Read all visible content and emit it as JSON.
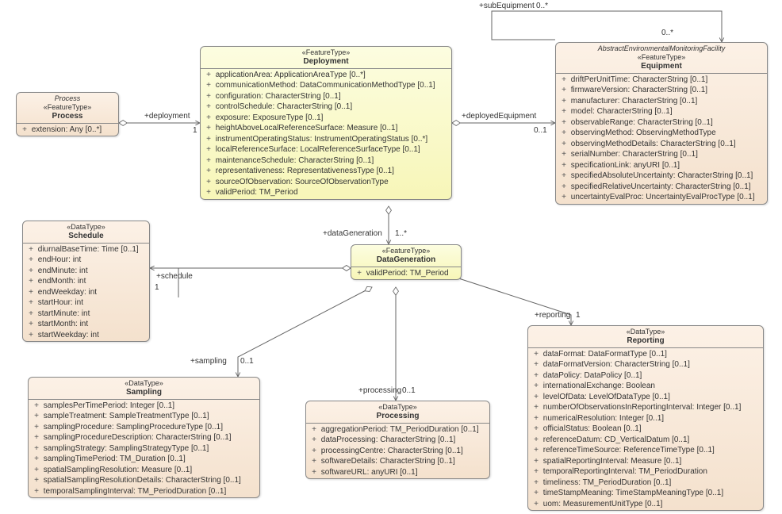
{
  "boxes": {
    "process": {
      "topnote": "Process",
      "stereo": "«FeatureType»",
      "name": "Process",
      "attrs": [
        "extension: Any [0..*]"
      ]
    },
    "deployment": {
      "stereo": "«FeatureType»",
      "name": "Deployment",
      "attrs": [
        "applicationArea: ApplicationAreaType [0..*]",
        "communicationMethod: DataCommunicationMethodType [0..1]",
        "configuration: CharacterString [0..1]",
        "controlSchedule: CharacterString [0..1]",
        "exposure: ExposureType [0..1]",
        "heightAboveLocalReferenceSurface: Measure [0..1]",
        "instrumentOperatingStatus: InstrumentOperatingStatus [0..*]",
        "localReferenceSurface: LocalReferenceSurfaceType [0..1]",
        "maintenanceSchedule: CharacterString [0..1]",
        "representativeness: RepresentativenessType [0..1]",
        "sourceOfObservation: SourceOfObservationType",
        "validPeriod: TM_Period"
      ]
    },
    "equipment": {
      "topnote": "AbstractEnvironmentalMonitoringFacility",
      "stereo": "«FeatureType»",
      "name": "Equipment",
      "attrs": [
        "driftPerUnitTime: CharacterString [0..1]",
        "firmwareVersion: CharacterString [0..1]",
        "manufacturer: CharacterString [0..1]",
        "model: CharacterString [0..1]",
        "observableRange: CharacterString [0..1]",
        "observingMethod: ObservingMethodType",
        "observingMethodDetails: CharacterString [0..1]",
        "serialNumber: CharacterString [0..1]",
        "specificationLink: anyURI [0..1]",
        "specifiedAbsoluteUncertainty: CharacterString [0..1]",
        "specifiedRelativeUncertainty: CharacterString [0..1]",
        "uncertaintyEvalProc: UncertaintyEvalProcType [0..1]"
      ]
    },
    "schedule": {
      "stereo": "«DataType»",
      "name": "Schedule",
      "attrs": [
        "diurnalBaseTime: Time [0..1]",
        "endHour: int",
        "endMinute: int",
        "endMonth: int",
        "endWeekday: int",
        "startHour: int",
        "startMinute: int",
        "startMonth: int",
        "startWeekday: int"
      ]
    },
    "datagen": {
      "stereo": "«FeatureType»",
      "name": "DataGeneration",
      "attrs": [
        "validPeriod: TM_Period"
      ]
    },
    "sampling": {
      "stereo": "«DataType»",
      "name": "Sampling",
      "attrs": [
        "samplesPerTimePeriod: Integer [0..1]",
        "sampleTreatment: SampleTreatmentType [0..1]",
        "samplingProcedure: SamplingProcedureType [0..1]",
        "samplingProcedureDescription: CharacterString [0..1]",
        "samplingStrategy: SamplingStrategyType [0..1]",
        "samplingTimePeriod: TM_Duration [0..1]",
        "spatialSamplingResolution: Measure [0..1]",
        "spatialSamplingResolutionDetails: CharacterString [0..1]",
        "temporalSamplingInterval: TM_PeriodDuration [0..1]"
      ]
    },
    "processing": {
      "stereo": "«DataType»",
      "name": "Processing",
      "attrs": [
        "aggregationPeriod: TM_PeriodDuration [0..1]",
        "dataProcessing: CharacterString [0..1]",
        "processingCentre: CharacterString [0..1]",
        "softwareDetails: CharacterString [0..1]",
        "softwareURL: anyURI [0..1]"
      ]
    },
    "reporting": {
      "stereo": "«DataType»",
      "name": "Reporting",
      "attrs": [
        "dataFormat: DataFormatType [0..1]",
        "dataFormatVersion: CharacterString [0..1]",
        "dataPolicy: DataPolicy [0..1]",
        "internationalExchange: Boolean",
        "levelOfData: LevelOfDataType [0..1]",
        "numberOfObservationsInReportingInterval: Integer [0..1]",
        "numericalResolution: Integer [0..1]",
        "officialStatus: Boolean [0..1]",
        "referenceDatum: CD_VerticalDatum [0..1]",
        "referenceTimeSource: ReferenceTimeType [0..1]",
        "spatialReportingInterval: Measure [0..1]",
        "temporalReportingInterval: TM_PeriodDuration",
        "timeliness: TM_PeriodDuration [0..1]",
        "timeStampMeaning: TimeStampMeaningType [0..1]",
        "uom: MeasurementUnitType [0..1]"
      ]
    }
  },
  "labels": {
    "subEquipment": "+subEquipment",
    "subEquipMult1": "0..*",
    "subEquipMult2": "0..*",
    "deployment": "+deployment",
    "deploymentMult": "1",
    "deployedEquipment": "+deployedEquipment",
    "deployedEquipmentMult": "0..1",
    "dataGeneration": "+dataGeneration",
    "dataGenerationMult": "1..*",
    "schedule": "+schedule",
    "scheduleMult": "1",
    "sampling": "+sampling",
    "samplingMult": "0..1",
    "processing": "+processing",
    "processingMult": "0..1",
    "reporting": "+reporting",
    "reportingMult": "1"
  }
}
